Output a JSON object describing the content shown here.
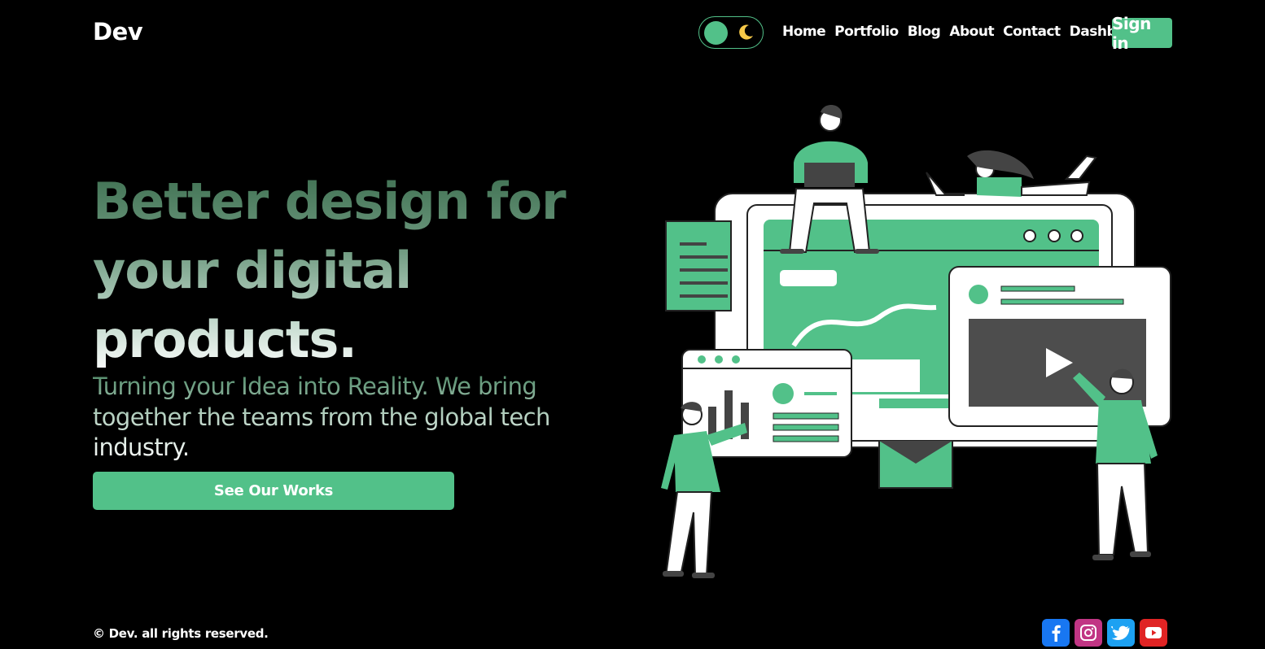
{
  "header": {
    "logo": "Dev",
    "nav": [
      "Home",
      "Portfolio",
      "Blog",
      "About",
      "Contact",
      "Dashboard"
    ],
    "signin_label": "Sign in",
    "theme_toggle_icon": "moon-icon"
  },
  "hero": {
    "title": "Better design for your digital products.",
    "subtitle": "Turning your Idea into Reality. We bring together the teams from the global tech industry.",
    "cta_label": "See Our Works"
  },
  "footer": {
    "copyright": "© Dev. all rights reserved.",
    "socials": [
      "facebook-icon",
      "instagram-icon",
      "twitter-icon",
      "youtube-icon"
    ]
  },
  "colors": {
    "accent": "#52c189",
    "background": "#000000",
    "facebook": "#1877f2",
    "instagram": "#c13584",
    "twitter": "#1da1f2",
    "youtube": "#e02424"
  }
}
